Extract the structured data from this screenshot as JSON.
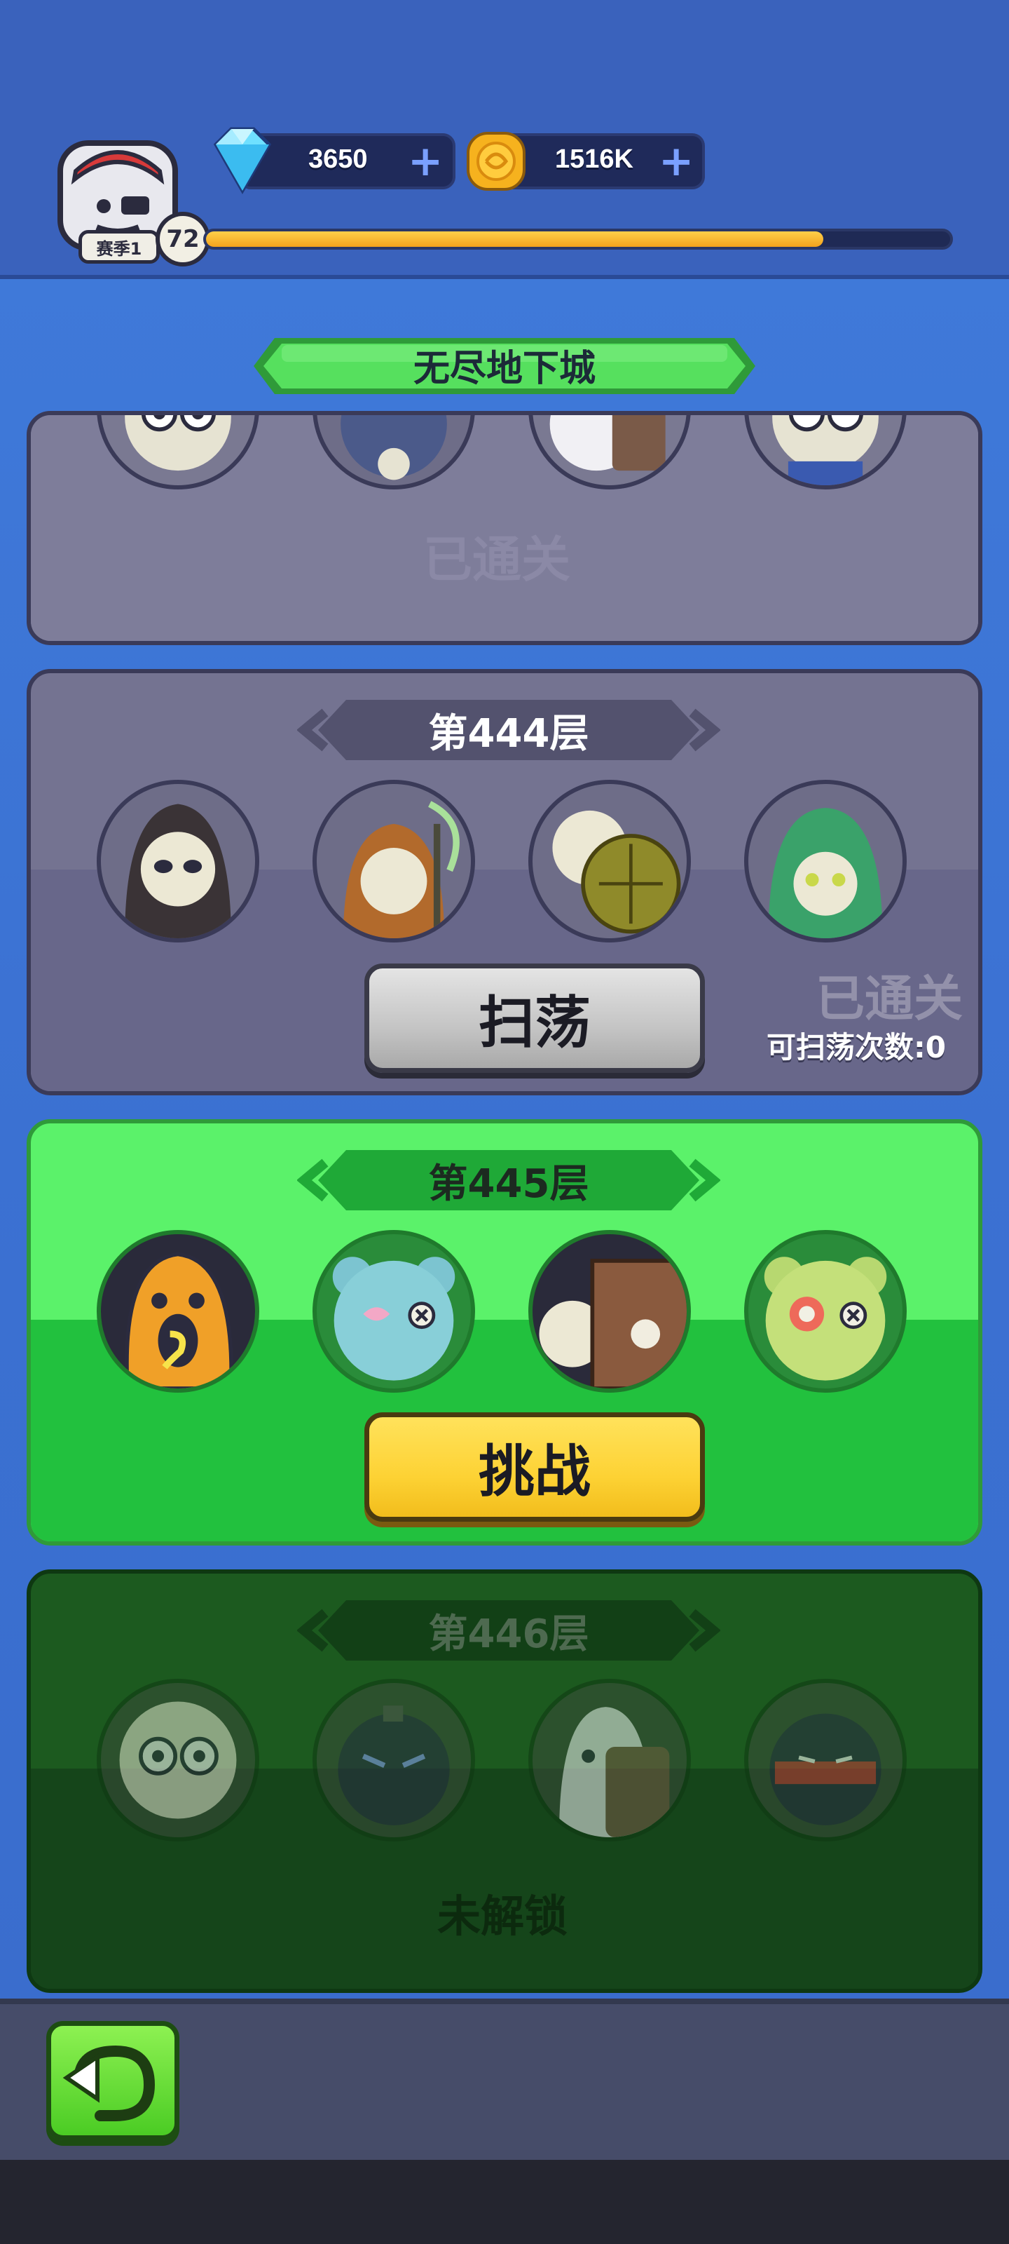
{
  "header": {
    "season_label": "赛季1",
    "level": "72",
    "xp_progress": 0.83,
    "currencies": [
      {
        "icon": "diamond-icon",
        "value": "3650"
      },
      {
        "icon": "gold-coin-icon",
        "value": "1516K"
      }
    ]
  },
  "title": "无尽地下城",
  "floors": [
    {
      "label": "",
      "status": "已通关"
    },
    {
      "label": "第444层",
      "button": "扫荡",
      "status": "已通关",
      "sweep_count": "可扫荡次数:0"
    },
    {
      "label": "第445层",
      "button": "挑战"
    },
    {
      "label": "第446层",
      "status": "未解锁"
    }
  ],
  "colors": {
    "accent_green": "#5bf26a",
    "locked_green": "#1c5a1f",
    "cleared_grey": "#747391",
    "challenge_yellow": "#fdd234"
  }
}
